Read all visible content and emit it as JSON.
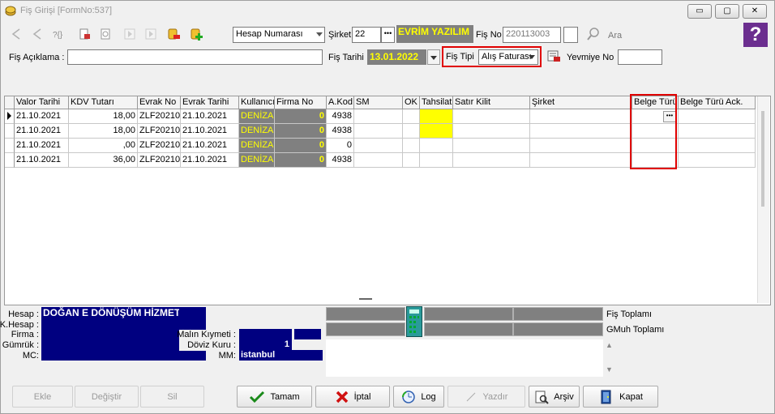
{
  "window": {
    "title": "Fiş Girişi [FormNo:537]",
    "controls": {
      "minimize": "▭",
      "maximize": "▢",
      "close": "✕"
    }
  },
  "toolbar": {
    "account_type": "Hesap Numarası",
    "company_label": "Şirket",
    "company_code": "22",
    "company_browse": "•••",
    "company_name": "EVRİM YAZILIM",
    "slip_no_label": "Fiş No",
    "slip_no": "220113003",
    "search_label": "Ara",
    "help": "?"
  },
  "form": {
    "description_label": "Fiş Açıklama :",
    "description_value": "",
    "date_label": "Fiş Tarihi",
    "date_value": "13.01.2022",
    "type_label": "Fiş  Tipi",
    "type_value": "Alış Faturası",
    "journal_label": "Yevmiye No",
    "journal_value": ""
  },
  "grid": {
    "columns": [
      "Valor Tarihi",
      "KDV Tutarı",
      "Evrak No",
      "Evrak Tarihi",
      "Kullanıcı",
      "Firma No",
      "A.Kod",
      "SM",
      "OK",
      "Tahsilat",
      "Satır Kilit",
      "Şirket",
      "Belge Türü",
      "Belge Türü Ack."
    ],
    "rows": [
      {
        "valor": "21.10.2021",
        "kdv": "18,00",
        "evrak_no": "ZLF20210",
        "evrak_tarihi": "21.10.2021",
        "user": "DENİZA",
        "firma": "0",
        "akod": "4938",
        "belge_btn": "•••"
      },
      {
        "valor": "21.10.2021",
        "kdv": "18,00",
        "evrak_no": "ZLF20210",
        "evrak_tarihi": "21.10.2021",
        "user": "DENİZA",
        "firma": "0",
        "akod": "4938",
        "belge_btn": ""
      },
      {
        "valor": "21.10.2021",
        "kdv": ",00",
        "evrak_no": "ZLF20210",
        "evrak_tarihi": "21.10.2021",
        "user": "DENİZA",
        "firma": "0",
        "akod": "0",
        "belge_btn": ""
      },
      {
        "valor": "21.10.2021",
        "kdv": "36,00",
        "evrak_no": "ZLF20210",
        "evrak_tarihi": "21.10.2021",
        "user": "DENİZA",
        "firma": "0",
        "akod": "4938",
        "belge_btn": ""
      }
    ]
  },
  "info": {
    "account_label": "Hesap :",
    "account_value": "DOĞAN E DÖNÜŞÜM HİZMETL",
    "k_account_label": "K.Hesap :",
    "company_label": "Firma :",
    "customs_label": "Gümrük :",
    "mc_label": "MC:",
    "goods_value_label": "Malın Kıymeti :",
    "fx_rate_label": "Döviz Kuru :",
    "fx_rate_value": "1",
    "mm_label": "MM:",
    "mm_value": "istanbul",
    "slip_total_label": "Fiş Toplamı",
    "gmuh_total_label": "GMuh Toplamı"
  },
  "buttons": {
    "add": "Ekle",
    "change": "Değiştir",
    "delete": "Sil",
    "ok": "Tamam",
    "cancel": "İptal",
    "log": "Log",
    "print": "Yazdır",
    "archive": "Arşiv",
    "close": "Kapat"
  },
  "colors": {
    "highlight_red": "#e00000",
    "company_bg": "#808080",
    "company_fg": "#ffff00",
    "navy": "#000080",
    "yellow_cell": "#ffff00",
    "help_purple": "#6b2e8f"
  }
}
